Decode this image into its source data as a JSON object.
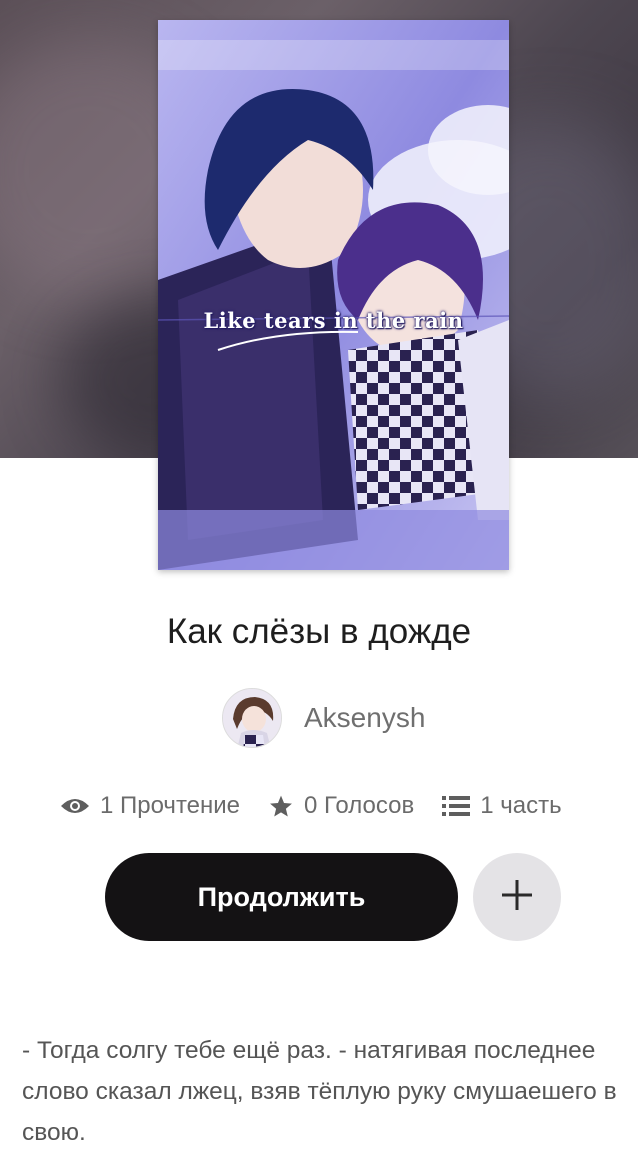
{
  "story": {
    "cover_caption": "Like tears in the rain",
    "title": "Как слёзы в дожде",
    "author": "Aksenysh",
    "description": "- Тогда солгу тебе ещё раз. - натягивая последнее слово сказал лжец, взяв тёплую руку смушаешего в свою."
  },
  "stats": {
    "reads": "1 Прочтение",
    "reads_icon": "eye-icon",
    "votes": "0 Голосов",
    "votes_icon": "star-icon",
    "parts": "1 часть",
    "parts_icon": "list-icon"
  },
  "actions": {
    "continue_label": "Продолжить",
    "add_icon": "plus-icon"
  },
  "colors": {
    "button_dark": "#141214",
    "add_button_bg": "#e4e3e6",
    "stat_text": "#6b6b6b"
  }
}
